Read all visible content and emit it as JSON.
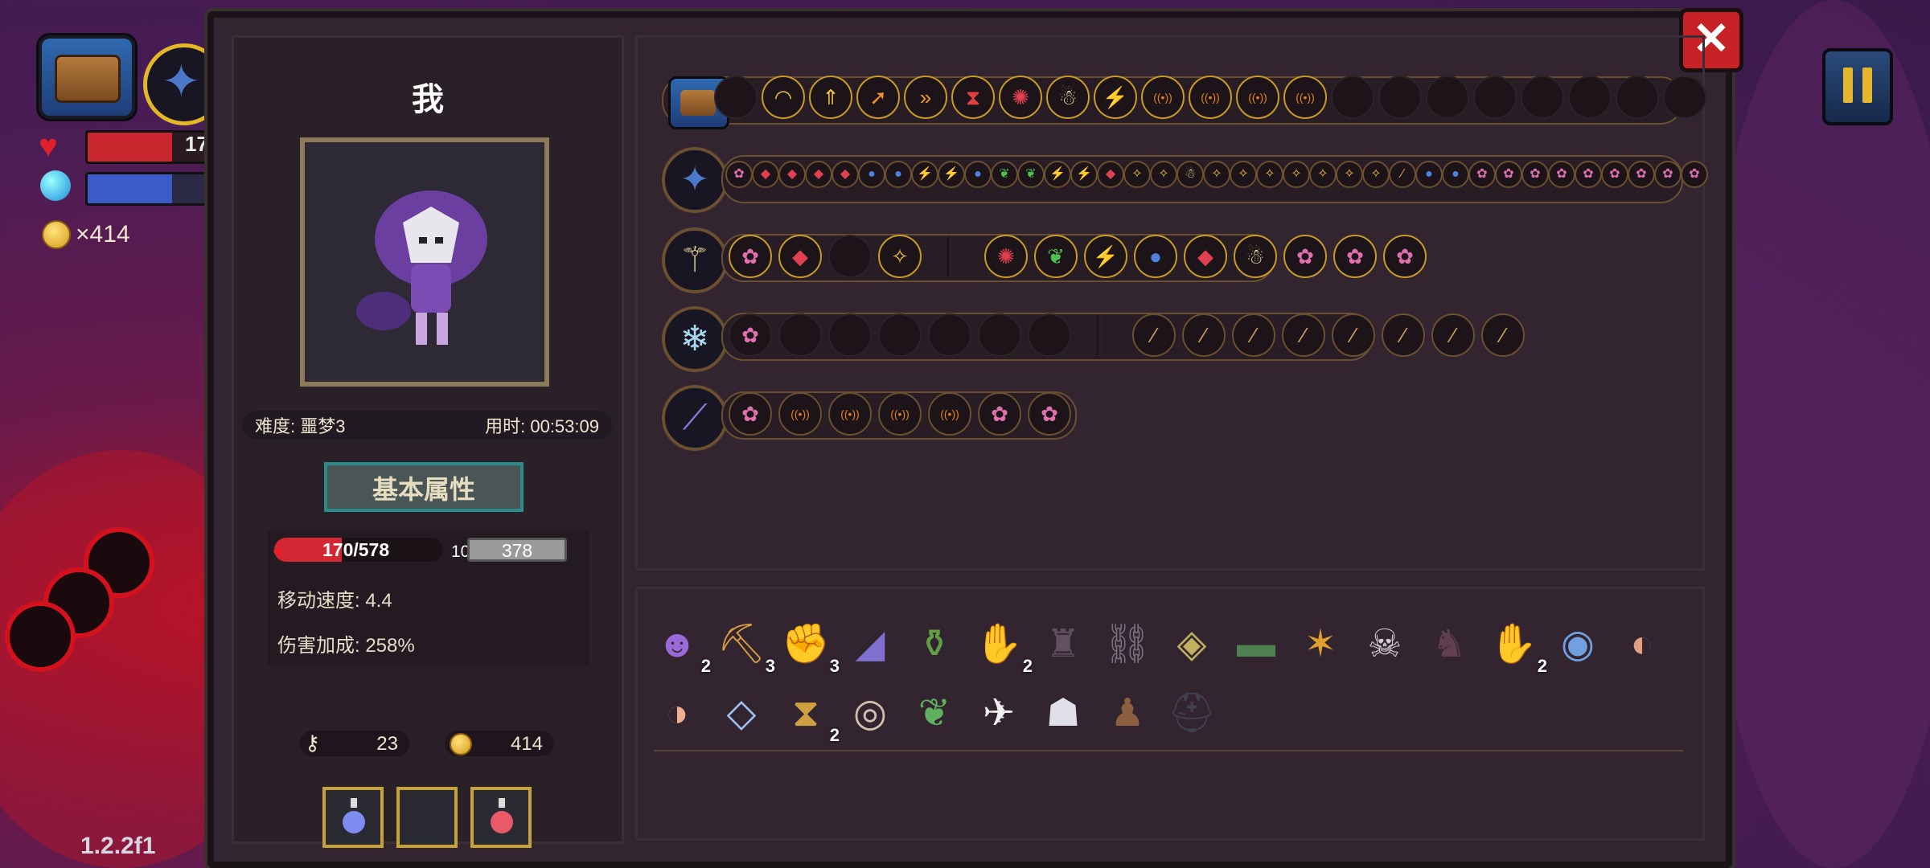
{
  "hud": {
    "hp_text": "17",
    "coins_text": "×414",
    "version": "1.2.2f1"
  },
  "panel": {
    "close_label": "✕",
    "character": {
      "name": "我",
      "difficulty": "难度: 噩梦3",
      "time": "用时: 00:53:09",
      "attributes_button": "基本属性",
      "hp": "170/578",
      "hp_extra": "10",
      "shield": "378",
      "move_speed": "移动速度: 4.4",
      "damage_bonus": "伤害加成: 258%",
      "keys": "23",
      "gold": "414"
    },
    "rows": [
      {
        "icons": [
          "chest",
          "empty",
          "rainbow-arc",
          "arrows-up",
          "arrow-diag",
          "double-chevron",
          "hourglass",
          "spiral",
          "ghost",
          "claw",
          "signal",
          "signal",
          "signal",
          "signal",
          "empty",
          "empty",
          "empty",
          "empty",
          "empty",
          "empty",
          "empty",
          "empty"
        ]
      },
      {
        "icons": [
          "weapon-shuriken"
        ]
      },
      {
        "icons": [
          "weapon-staff"
        ]
      },
      {
        "icons": [
          "weapon-wand"
        ]
      },
      {
        "icons": [
          "weapon-spear"
        ]
      }
    ],
    "items": [
      {
        "name": "purple-hair-mask",
        "count": "2"
      },
      {
        "name": "pickaxe",
        "count": "3"
      },
      {
        "name": "bracer",
        "count": "3"
      },
      {
        "name": "rainbow-cape",
        "count": ""
      },
      {
        "name": "green-pot",
        "count": ""
      },
      {
        "name": "purple-glove",
        "count": "2"
      },
      {
        "name": "cloak",
        "count": ""
      },
      {
        "name": "chain",
        "count": ""
      },
      {
        "name": "gem-cube",
        "count": ""
      },
      {
        "name": "green-belt",
        "count": ""
      },
      {
        "name": "rune-card",
        "count": ""
      },
      {
        "name": "skeleton-chest",
        "count": ""
      },
      {
        "name": "dark-armor",
        "count": ""
      },
      {
        "name": "blue-gauntlet",
        "count": "2"
      },
      {
        "name": "orb-amulet",
        "count": ""
      },
      {
        "name": "ear",
        "count": ""
      },
      {
        "name": "nose",
        "count": ""
      },
      {
        "name": "ice-crystal",
        "count": ""
      },
      {
        "name": "hourglass",
        "count": "2"
      },
      {
        "name": "goggles",
        "count": ""
      },
      {
        "name": "leaf",
        "count": ""
      },
      {
        "name": "wing",
        "count": ""
      },
      {
        "name": "white-mask",
        "count": ""
      },
      {
        "name": "totem",
        "count": ""
      },
      {
        "name": "helmet",
        "count": ""
      }
    ]
  }
}
